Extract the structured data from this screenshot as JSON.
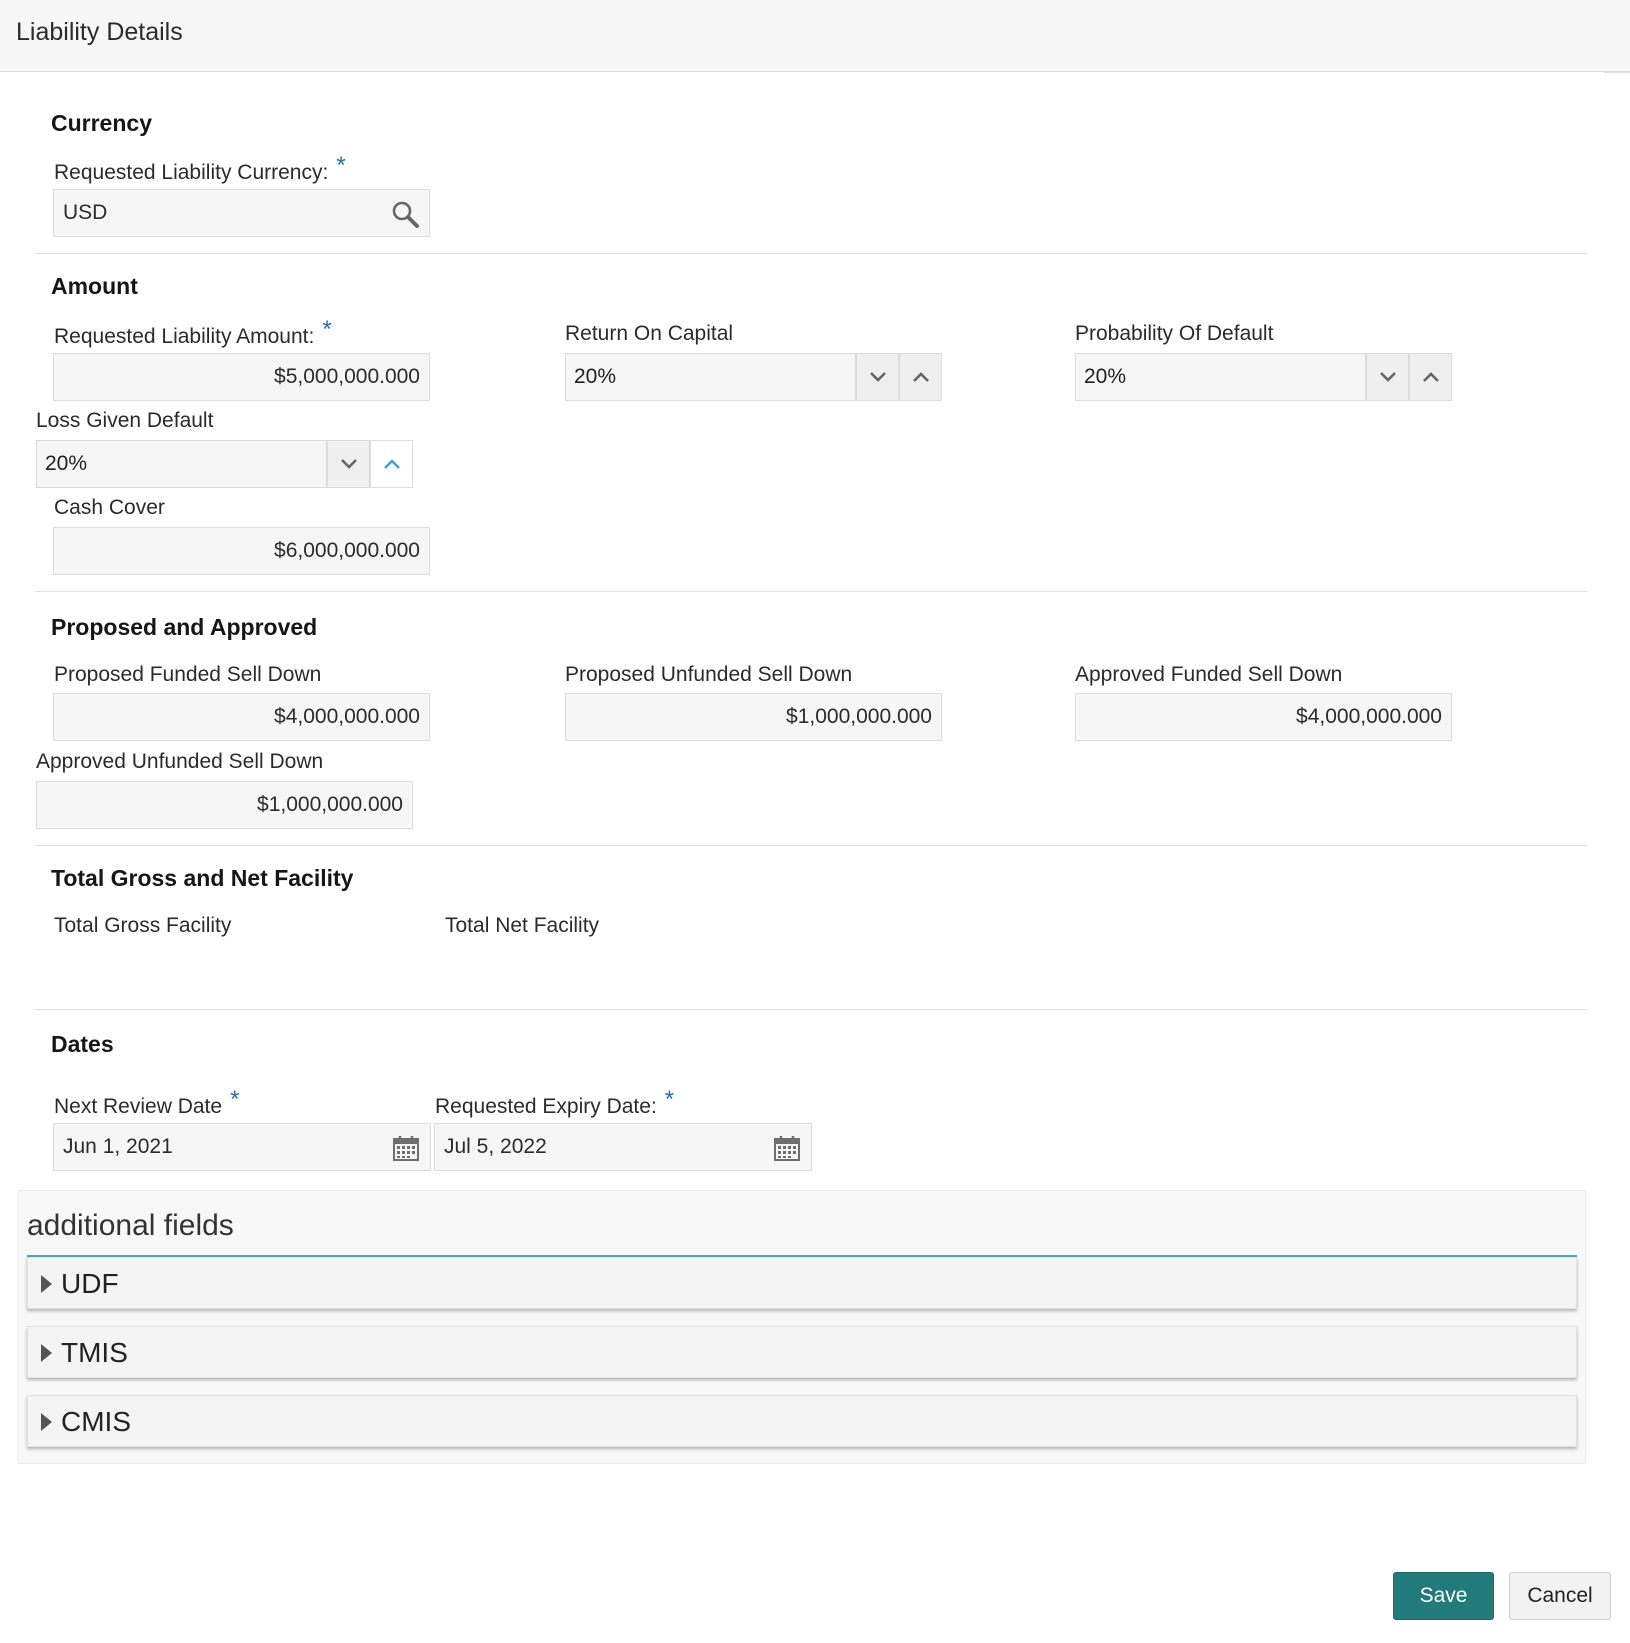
{
  "header": {
    "title": "Liability Details"
  },
  "currency": {
    "section_title": "Currency",
    "requested_currency": {
      "label": "Requested Liability Currency:",
      "required": "*",
      "value": "USD",
      "icon": "search-icon"
    }
  },
  "amount": {
    "section_title": "Amount",
    "requested_amount": {
      "label": "Requested Liability Amount:",
      "required": "*",
      "value": "$5,000,000.000"
    },
    "return_on_capital": {
      "label": "Return On Capital",
      "value": "20%"
    },
    "probability_of_default": {
      "label": "Probability Of Default",
      "value": "20%"
    },
    "loss_given_default": {
      "label": "Loss Given Default",
      "value": "20%"
    },
    "cash_cover": {
      "label": "Cash Cover",
      "value": "$6,000,000.000"
    }
  },
  "proposed": {
    "section_title": "Proposed and Approved",
    "proposed_funded": {
      "label": "Proposed Funded Sell Down",
      "value": "$4,000,000.000"
    },
    "proposed_unfunded": {
      "label": "Proposed Unfunded Sell Down",
      "value": "$1,000,000.000"
    },
    "approved_funded": {
      "label": "Approved Funded Sell Down",
      "value": "$4,000,000.000"
    },
    "approved_unfunded": {
      "label": "Approved Unfunded Sell Down",
      "value": "$1,000,000.000"
    }
  },
  "totals": {
    "section_title": "Total Gross and Net Facility",
    "gross_label": "Total Gross Facility",
    "net_label": "Total Net Facility"
  },
  "dates": {
    "section_title": "Dates",
    "next_review": {
      "label": "Next Review Date",
      "required": "*",
      "value": "Jun 1, 2021",
      "icon": "calendar-icon"
    },
    "requested_expiry": {
      "label": "Requested Expiry Date:",
      "required": "*",
      "value": "Jul 5, 2022",
      "icon": "calendar-icon"
    }
  },
  "additional_fields": {
    "title": "additional fields",
    "panels": [
      {
        "label": "UDF"
      },
      {
        "label": "TMIS"
      },
      {
        "label": "CMIS"
      }
    ]
  },
  "footer": {
    "save_label": "Save",
    "cancel_label": "Cancel"
  },
  "colors": {
    "accent": "#237a7a",
    "required": "#2a6fa8",
    "rule": "#4fa8ad"
  }
}
